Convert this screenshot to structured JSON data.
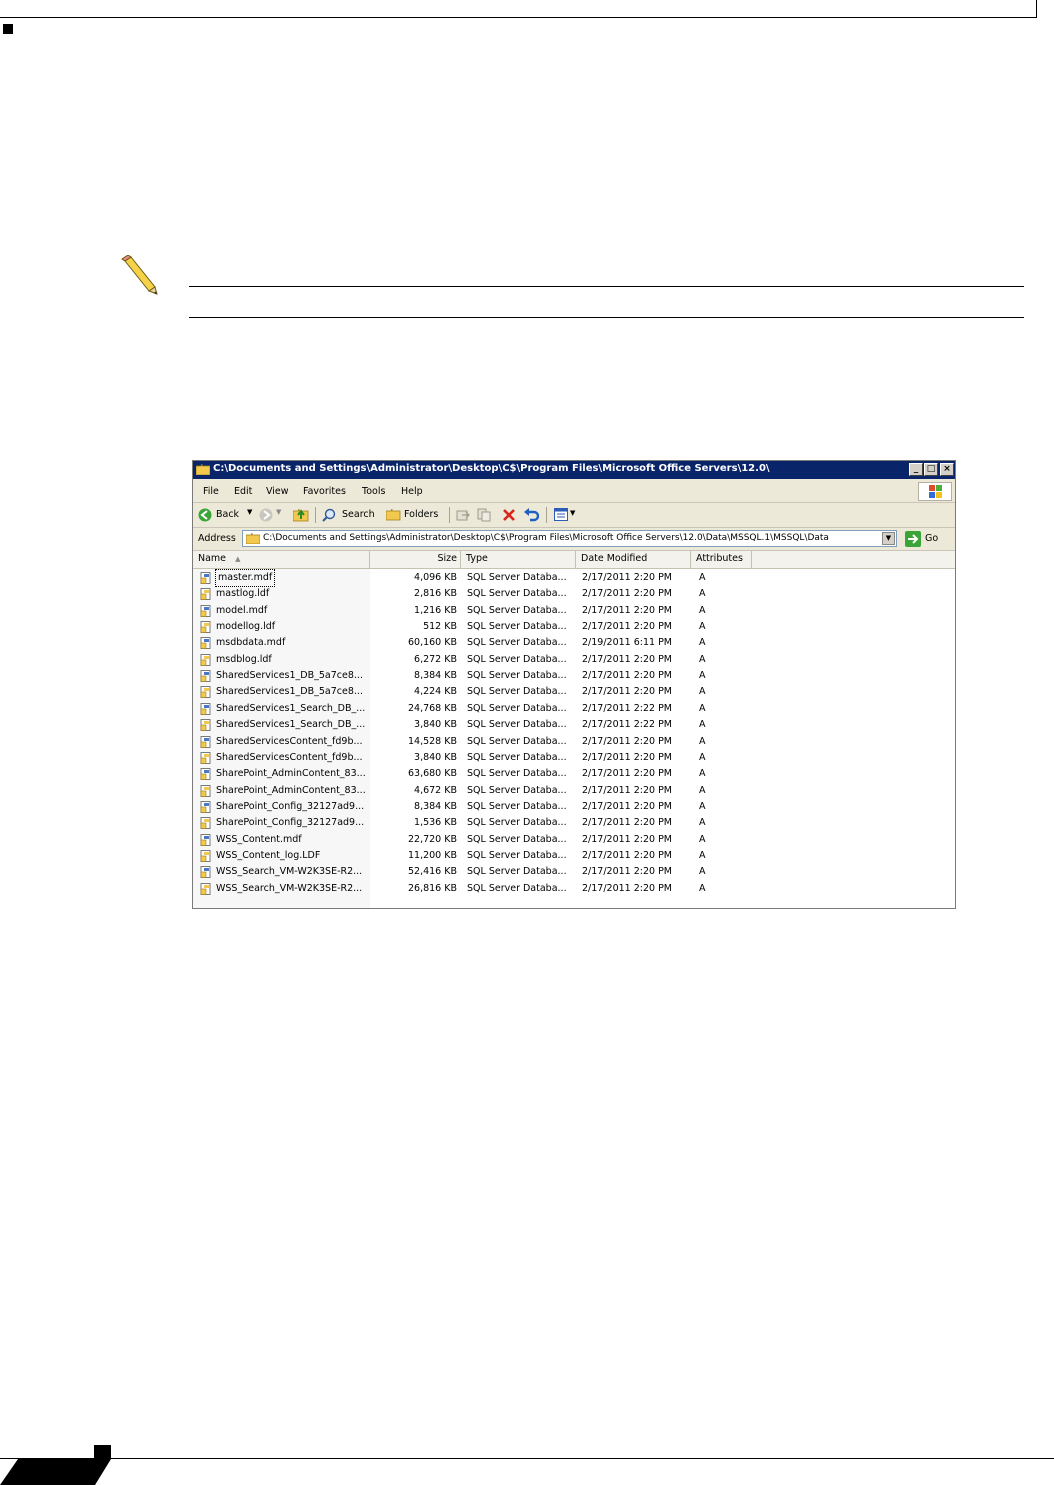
{
  "window": {
    "title": "C:\\Documents and Settings\\Administrator\\Desktop\\C$\\Program Files\\Microsoft Office Servers\\12.0\\",
    "controls": [
      "_",
      "□",
      "×"
    ]
  },
  "menu": {
    "file": "File",
    "edit": "Edit",
    "view": "View",
    "favorites": "Favorites",
    "tools": "Tools",
    "help": "Help"
  },
  "toolbar": {
    "back": "Back",
    "search": "Search",
    "folders": "Folders"
  },
  "address": {
    "label": "Address",
    "value": "C:\\Documents and Settings\\Administrator\\Desktop\\C$\\Program Files\\Microsoft Office Servers\\12.0\\Data\\MSSQL.1\\MSSQL\\Data",
    "go": "Go"
  },
  "columns": {
    "name": "Name",
    "size": "Size",
    "type": "Type",
    "date": "Date Modified",
    "attributes": "Attributes"
  },
  "files": [
    {
      "name": "master.mdf",
      "size": "4,096 KB",
      "type": "SQL Server Databa...",
      "date": "2/17/2011 2:20 PM",
      "attr": "A"
    },
    {
      "name": "mastlog.ldf",
      "size": "2,816 KB",
      "type": "SQL Server Databa...",
      "date": "2/17/2011 2:20 PM",
      "attr": "A"
    },
    {
      "name": "model.mdf",
      "size": "1,216 KB",
      "type": "SQL Server Databa...",
      "date": "2/17/2011 2:20 PM",
      "attr": "A"
    },
    {
      "name": "modellog.ldf",
      "size": "512 KB",
      "type": "SQL Server Databa...",
      "date": "2/17/2011 2:20 PM",
      "attr": "A"
    },
    {
      "name": "msdbdata.mdf",
      "size": "60,160 KB",
      "type": "SQL Server Databa...",
      "date": "2/19/2011 6:11 PM",
      "attr": "A"
    },
    {
      "name": "msdblog.ldf",
      "size": "6,272 KB",
      "type": "SQL Server Databa...",
      "date": "2/17/2011 2:20 PM",
      "attr": "A"
    },
    {
      "name": "SharedServices1_DB_5a7ce8...",
      "size": "8,384 KB",
      "type": "SQL Server Databa...",
      "date": "2/17/2011 2:20 PM",
      "attr": "A"
    },
    {
      "name": "SharedServices1_DB_5a7ce8...",
      "size": "4,224 KB",
      "type": "SQL Server Databa...",
      "date": "2/17/2011 2:20 PM",
      "attr": "A"
    },
    {
      "name": "SharedServices1_Search_DB_...",
      "size": "24,768 KB",
      "type": "SQL Server Databa...",
      "date": "2/17/2011 2:22 PM",
      "attr": "A"
    },
    {
      "name": "SharedServices1_Search_DB_...",
      "size": "3,840 KB",
      "type": "SQL Server Databa...",
      "date": "2/17/2011 2:22 PM",
      "attr": "A"
    },
    {
      "name": "SharedServicesContent_fd9b...",
      "size": "14,528 KB",
      "type": "SQL Server Databa...",
      "date": "2/17/2011 2:20 PM",
      "attr": "A"
    },
    {
      "name": "SharedServicesContent_fd9b...",
      "size": "3,840 KB",
      "type": "SQL Server Databa...",
      "date": "2/17/2011 2:20 PM",
      "attr": "A"
    },
    {
      "name": "SharePoint_AdminContent_83...",
      "size": "63,680 KB",
      "type": "SQL Server Databa...",
      "date": "2/17/2011 2:20 PM",
      "attr": "A"
    },
    {
      "name": "SharePoint_AdminContent_83...",
      "size": "4,672 KB",
      "type": "SQL Server Databa...",
      "date": "2/17/2011 2:20 PM",
      "attr": "A"
    },
    {
      "name": "SharePoint_Config_32127ad9...",
      "size": "8,384 KB",
      "type": "SQL Server Databa...",
      "date": "2/17/2011 2:20 PM",
      "attr": "A"
    },
    {
      "name": "SharePoint_Config_32127ad9...",
      "size": "1,536 KB",
      "type": "SQL Server Databa...",
      "date": "2/17/2011 2:20 PM",
      "attr": "A"
    },
    {
      "name": "WSS_Content.mdf",
      "size": "22,720 KB",
      "type": "SQL Server Databa...",
      "date": "2/17/2011 2:20 PM",
      "attr": "A"
    },
    {
      "name": "WSS_Content_log.LDF",
      "size": "11,200 KB",
      "type": "SQL Server Databa...",
      "date": "2/17/2011 2:20 PM",
      "attr": "A"
    },
    {
      "name": "WSS_Search_VM-W2K3SE-R2...",
      "size": "52,416 KB",
      "type": "SQL Server Databa...",
      "date": "2/17/2011 2:20 PM",
      "attr": "A"
    },
    {
      "name": "WSS_Search_VM-W2K3SE-R2...",
      "size": "26,816 KB",
      "type": "SQL Server Databa...",
      "date": "2/17/2011 2:20 PM",
      "attr": "A"
    }
  ],
  "colors": {
    "titlebar": "#0a246a",
    "chrome": "#ece9d8",
    "go_green": "#3aa536",
    "folder_yellow": "#f2c94c",
    "delete_red": "#d9261c"
  },
  "icons": [
    "pencil-note-icon",
    "folder-icon",
    "back-icon",
    "forward-icon",
    "up-folder-icon",
    "search-icon",
    "folders-icon",
    "move-to-icon",
    "copy-to-icon",
    "delete-icon",
    "undo-icon",
    "views-icon",
    "go-arrow-icon",
    "file-icon",
    "windows-logo-icon"
  ]
}
